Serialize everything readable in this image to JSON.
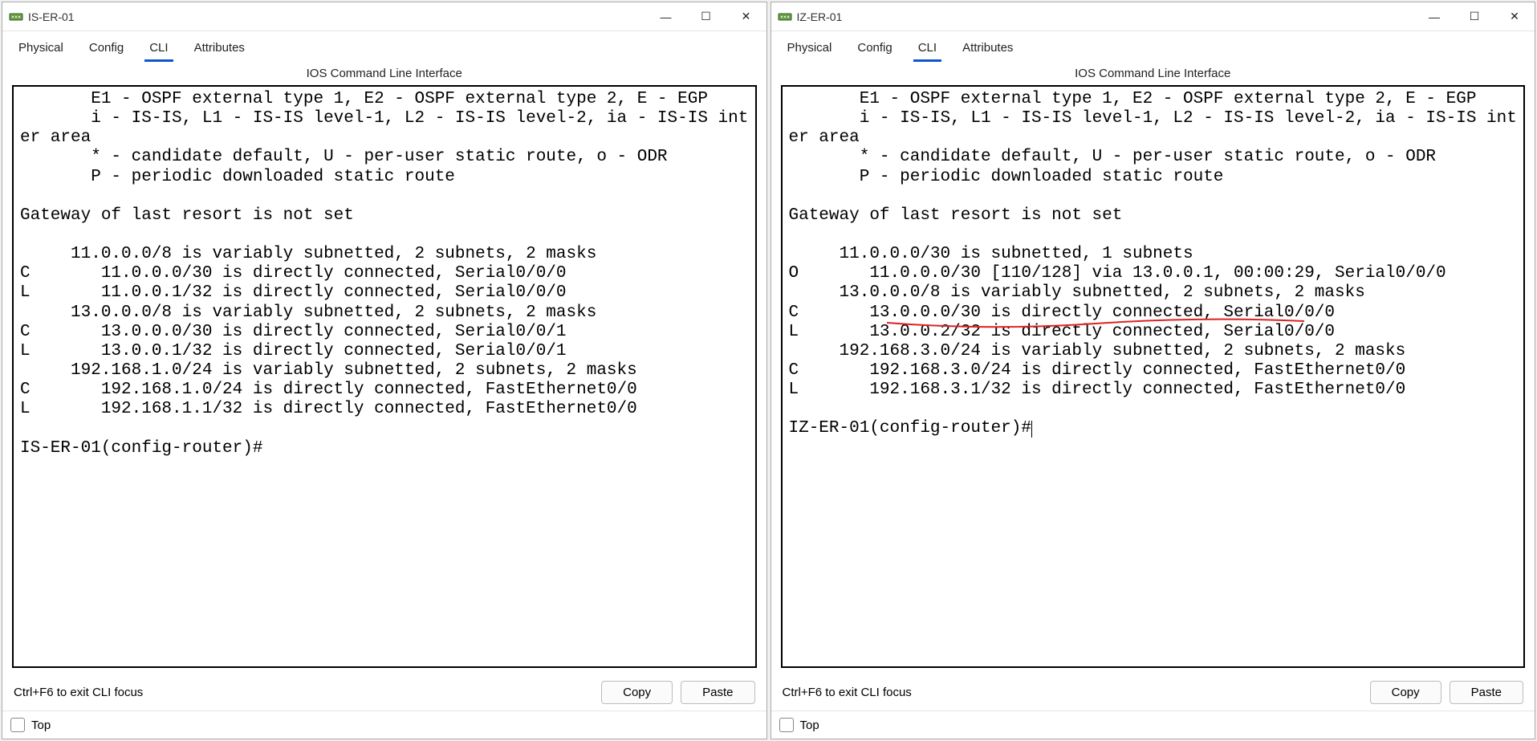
{
  "windows": [
    {
      "title": "IS-ER-01",
      "tabs": {
        "physical": "Physical",
        "config": "Config",
        "cli": "CLI",
        "attributes": "Attributes",
        "active": "cli"
      },
      "panel_header": "IOS Command Line Interface",
      "cli_text": "       E1 - OSPF external type 1, E2 - OSPF external type 2, E - EGP\n       i - IS-IS, L1 - IS-IS level-1, L2 - IS-IS level-2, ia - IS-IS inter area\n       * - candidate default, U - per-user static route, o - ODR\n       P - periodic downloaded static route\n\nGateway of last resort is not set\n\n     11.0.0.0/8 is variably subnetted, 2 subnets, 2 masks\nC       11.0.0.0/30 is directly connected, Serial0/0/0\nL       11.0.0.1/32 is directly connected, Serial0/0/0\n     13.0.0.0/8 is variably subnetted, 2 subnets, 2 masks\nC       13.0.0.0/30 is directly connected, Serial0/0/1\nL       13.0.0.1/32 is directly connected, Serial0/0/1\n     192.168.1.0/24 is variably subnetted, 2 subnets, 2 masks\nC       192.168.1.0/24 is directly connected, FastEthernet0/0\nL       192.168.1.1/32 is directly connected, FastEthernet0/0\n\nIS-ER-01(config-router)#",
      "hint": "Ctrl+F6 to exit CLI focus",
      "copy_label": "Copy",
      "paste_label": "Paste",
      "top_label": "Top"
    },
    {
      "title": "IZ-ER-01",
      "tabs": {
        "physical": "Physical",
        "config": "Config",
        "cli": "CLI",
        "attributes": "Attributes",
        "active": "cli"
      },
      "panel_header": "IOS Command Line Interface",
      "cli_text": "       E1 - OSPF external type 1, E2 - OSPF external type 2, E - EGP\n       i - IS-IS, L1 - IS-IS level-1, L2 - IS-IS level-2, ia - IS-IS inter area\n       * - candidate default, U - per-user static route, o - ODR\n       P - periodic downloaded static route\n\nGateway of last resort is not set\n\n     11.0.0.0/30 is subnetted, 1 subnets\nO       11.0.0.0/30 [110/128] via 13.0.0.1, 00:00:29, Serial0/0/0\n     13.0.0.0/8 is variably subnetted, 2 subnets, 2 masks\nC       13.0.0.0/30 is directly connected, Serial0/0/0\nL       13.0.0.2/32 is directly connected, Serial0/0/0\n     192.168.3.0/24 is variably subnetted, 2 subnets, 2 masks\nC       192.168.3.0/24 is directly connected, FastEthernet0/0\nL       192.168.3.1/32 is directly connected, FastEthernet0/0\n\nIZ-ER-01(config-router)#",
      "hint": "Ctrl+F6 to exit CLI focus",
      "copy_label": "Copy",
      "paste_label": "Paste",
      "top_label": "Top",
      "annotation": {
        "type": "red-underline"
      }
    }
  ]
}
